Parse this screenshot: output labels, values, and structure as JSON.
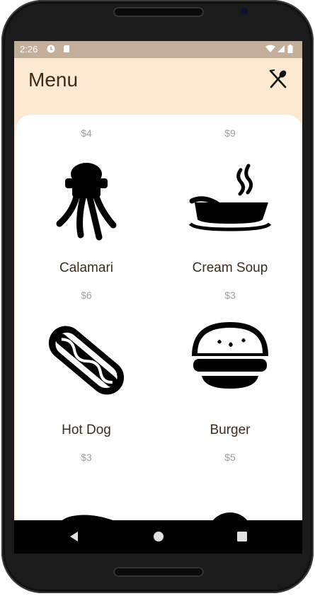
{
  "status": {
    "time": "2:26"
  },
  "header": {
    "title": "Menu",
    "icon": "fork-spoon-icon"
  },
  "menu": [
    {
      "price": "$4",
      "name": "Calamari",
      "icon": "squid-icon"
    },
    {
      "price": "$9",
      "name": "Cream Soup",
      "icon": "soup-bowl-icon"
    },
    {
      "price": "$6",
      "name": "Hot Dog",
      "icon": "hotdog-icon"
    },
    {
      "price": "$3",
      "name": "Burger",
      "icon": "burger-icon"
    },
    {
      "price": "$3",
      "name": "",
      "icon": "lemon-fish-icon"
    },
    {
      "price": "$5",
      "name": "",
      "icon": "dish-icon"
    }
  ],
  "navbar": {
    "buttons": [
      "back",
      "home",
      "recents"
    ]
  }
}
